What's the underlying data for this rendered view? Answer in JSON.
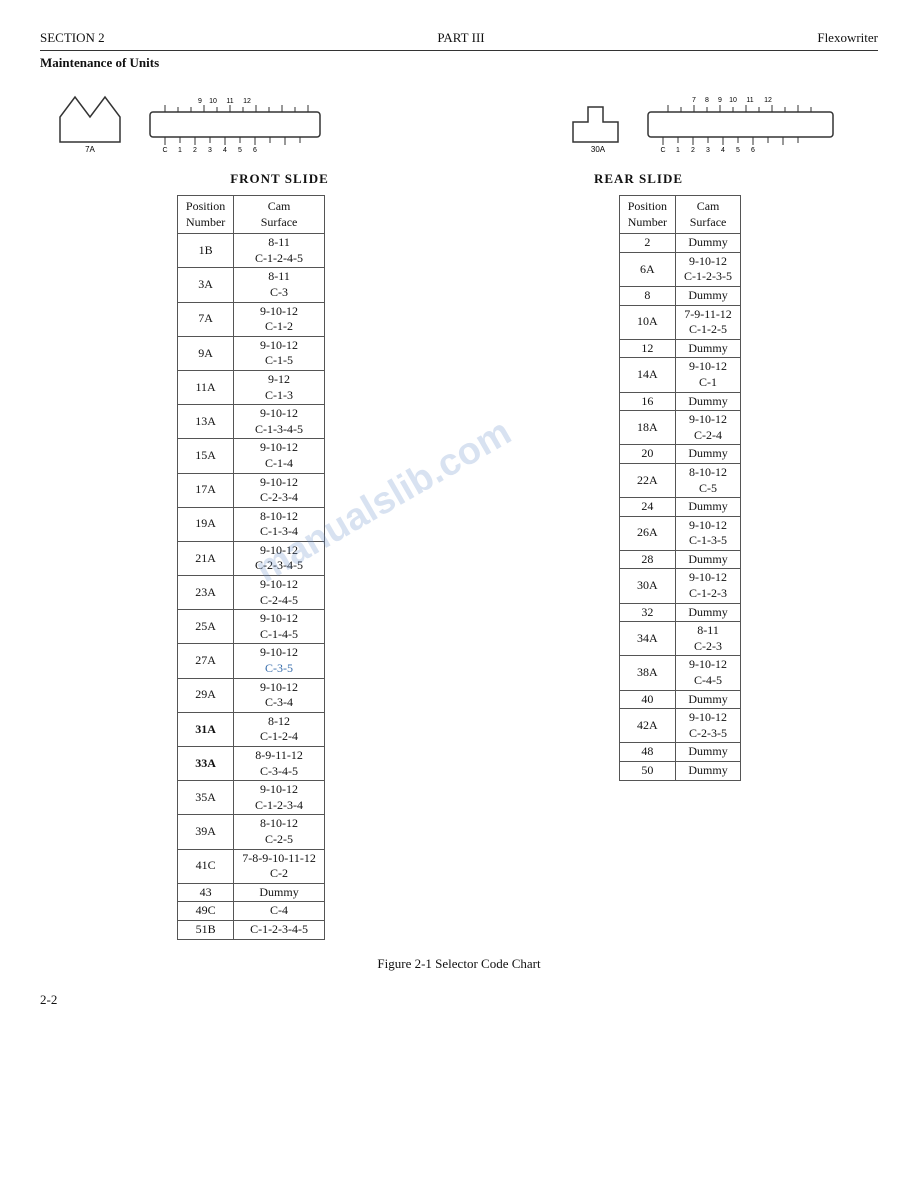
{
  "header": {
    "left": "SECTION 2",
    "center": "PART  III",
    "right": "Flexowriter"
  },
  "subheader": "Maintenance of Units",
  "front_slide_label": "FRONT SLIDE",
  "rear_slide_label": "REAR SLIDE",
  "front_table": {
    "col1": "Position\nNumber",
    "col2": "Cam\nSurface",
    "rows": [
      {
        "pos": "1B",
        "cam1": "8-11",
        "cam2": "C-1-2-4-5"
      },
      {
        "pos": "3A",
        "cam1": "8-11",
        "cam2": "C-3"
      },
      {
        "pos": "7A",
        "cam1": "9-10-12",
        "cam2": "C-1-2"
      },
      {
        "pos": "9A",
        "cam1": "9-10-12",
        "cam2": "C-1-5"
      },
      {
        "pos": "11A",
        "cam1": "9-12",
        "cam2": "C-1-3"
      },
      {
        "pos": "13A",
        "cam1": "9-10-12",
        "cam2": "C-1-3-4-5"
      },
      {
        "pos": "15A",
        "cam1": "9-10-12",
        "cam2": "C-1-4"
      },
      {
        "pos": "17A",
        "cam1": "9-10-12",
        "cam2": "C-2-3-4"
      },
      {
        "pos": "19A",
        "cam1": "8-10-12",
        "cam2": "C-1-3-4"
      },
      {
        "pos": "21A",
        "cam1": "9-10-12",
        "cam2": "C-2-3-4-5"
      },
      {
        "pos": "23A",
        "cam1": "9-10-12",
        "cam2": "C-2-4-5"
      },
      {
        "pos": "25A",
        "cam1": "9-10-12",
        "cam2": "C-1-4-5"
      },
      {
        "pos": "27A",
        "cam1": "9-10-12",
        "cam2": "C-3-5"
      },
      {
        "pos": "29A",
        "cam1": "9-10-12",
        "cam2": "C-3-4"
      },
      {
        "pos": "31A",
        "cam1": "8-12",
        "cam2": "C-1-2-4"
      },
      {
        "pos": "33A",
        "cam1": "8-9-11-12",
        "cam2": "C-3-4-5"
      },
      {
        "pos": "35A",
        "cam1": "9-10-12",
        "cam2": "C-1-2-3-4"
      },
      {
        "pos": "39A",
        "cam1": "8-10-12",
        "cam2": "C-2-5"
      },
      {
        "pos": "41C",
        "cam1": "7-8-9-10-11-12",
        "cam2": "C-2"
      },
      {
        "pos": "43",
        "cam1": "",
        "cam2": "Dummy"
      },
      {
        "pos": "49C",
        "cam1": "",
        "cam2": "C-4"
      },
      {
        "pos": "51B",
        "cam1": "",
        "cam2": "C-1-2-3-4-5"
      }
    ]
  },
  "rear_table": {
    "col1": "Position\nNumber",
    "col2": "Cam\nSurface",
    "rows": [
      {
        "pos": "2",
        "cam1": "",
        "cam2": "Dummy"
      },
      {
        "pos": "6A",
        "cam1": "9-10-12",
        "cam2": "C-1-2-3-5"
      },
      {
        "pos": "8",
        "cam1": "",
        "cam2": "Dummy"
      },
      {
        "pos": "10A",
        "cam1": "7-9-11-12",
        "cam2": "C-1-2-5"
      },
      {
        "pos": "12",
        "cam1": "",
        "cam2": "Dummy"
      },
      {
        "pos": "14A",
        "cam1": "9-10-12",
        "cam2": "C-1"
      },
      {
        "pos": "16",
        "cam1": "",
        "cam2": "Dummy"
      },
      {
        "pos": "18A",
        "cam1": "9-10-12",
        "cam2": "C-2-4"
      },
      {
        "pos": "20",
        "cam1": "",
        "cam2": "Dummy"
      },
      {
        "pos": "22A",
        "cam1": "8-10-12",
        "cam2": "C-5"
      },
      {
        "pos": "24",
        "cam1": "",
        "cam2": "Dummy"
      },
      {
        "pos": "26A",
        "cam1": "9-10-12",
        "cam2": "C-1-3-5"
      },
      {
        "pos": "28",
        "cam1": "",
        "cam2": "Dummy"
      },
      {
        "pos": "30A",
        "cam1": "9-10-12",
        "cam2": "C-1-2-3"
      },
      {
        "pos": "32",
        "cam1": "",
        "cam2": "Dummy"
      },
      {
        "pos": "34A",
        "cam1": "8-11",
        "cam2": "C-2-3"
      },
      {
        "pos": "38A",
        "cam1": "9-10-12",
        "cam2": "C-4-5"
      },
      {
        "pos": "40",
        "cam1": "",
        "cam2": "Dummy"
      },
      {
        "pos": "42A",
        "cam1": "9-10-12",
        "cam2": "C-2-3-5"
      },
      {
        "pos": "48",
        "cam1": "",
        "cam2": "Dummy"
      },
      {
        "pos": "50",
        "cam1": "",
        "cam2": "Dummy"
      }
    ]
  },
  "figure_caption": "Figure 2-1  Selector Code Chart",
  "page_number": "2-2",
  "watermark": "manualslib.com"
}
